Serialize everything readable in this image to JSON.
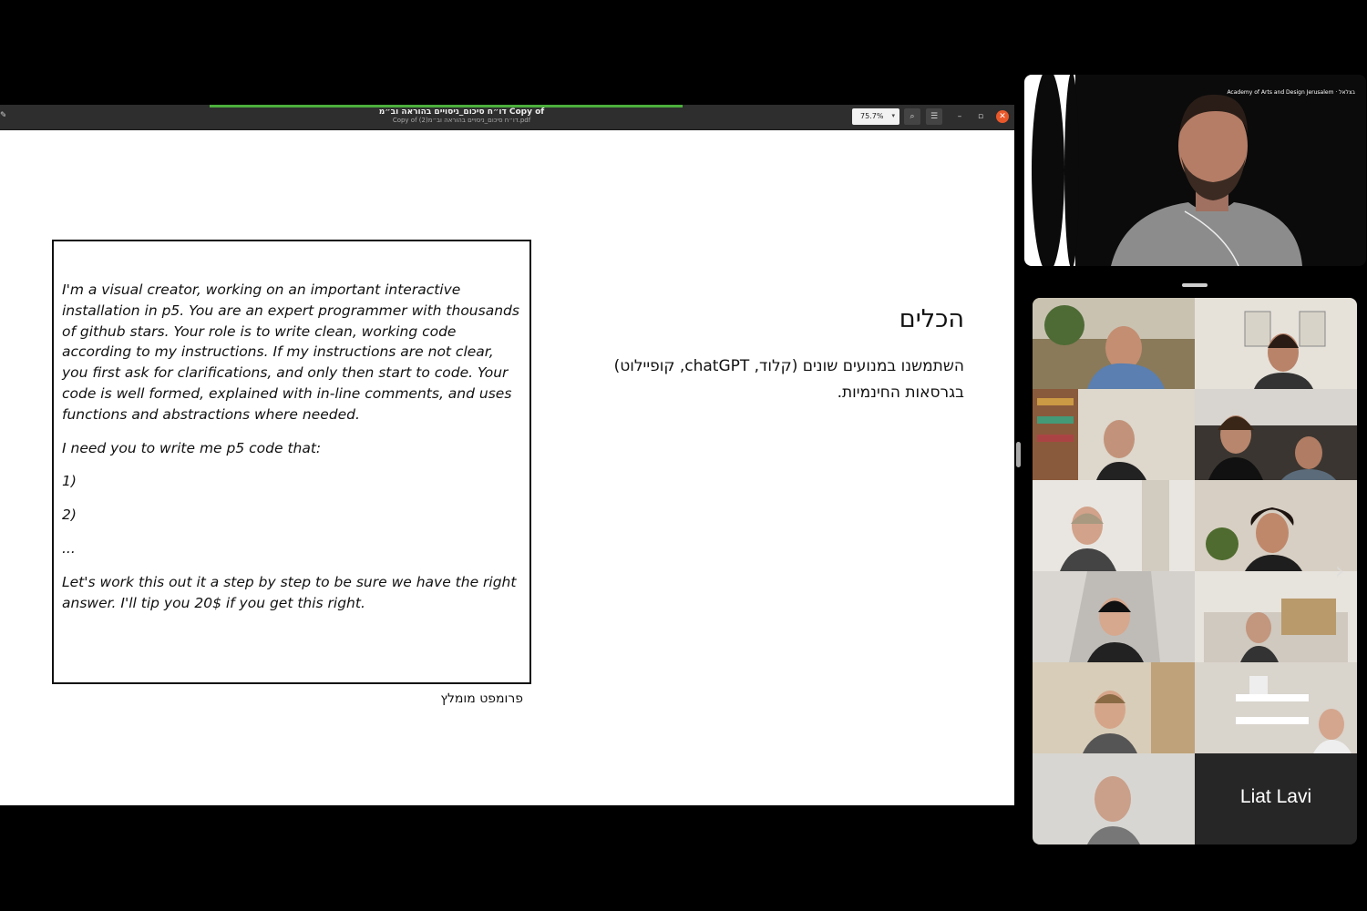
{
  "window": {
    "title": "דו״ח סיכום_ניסויים בהוראה וב״מ Copy of",
    "subtitle": "Copy of (2)דו״ח סיכום_ניסויים בהוראה וב״מ.pdf",
    "zoom": "75.7%",
    "zoom_caret": "▾",
    "icons": [
      "edit-icon",
      "search-icon",
      "menu-icon",
      "minimize-icon",
      "maximize-icon",
      "close-icon"
    ],
    "icon_glyphs": {
      "edit": "✎",
      "search": "⌕",
      "menu": "☰",
      "minimize": "–",
      "maximize": "▫",
      "close": "✕"
    },
    "load_progress": 0.47
  },
  "slide": {
    "prompt_paragraphs": [
      "I'm a visual creator, working on an important interactive installation in p5. You are an expert programmer with thousands of github stars. Your role is to write clean, working code according to my instructions. If my instructions are not clear, you first ask for clarifications, and only then start to code. Your code is well formed, explained with in-line comments, and uses functions and abstractions where needed.",
      "I need you to write me p5 code that:",
      "1)",
      "2)",
      "...",
      "Let's work this out it a step by step to be sure we have the right answer. I'll tip you 20$ if you get this right."
    ],
    "prompt_caption": "פרומפט מומלץ",
    "title": "הכלים",
    "body": "השתמשנו במנועים שונים (קלוד, chatGPT, קופיילוט) בגרסאות החינמיות."
  },
  "speaker": {
    "logo_text": "Academy of Arts and Design Jerusalem · בצלאל"
  },
  "gallery": {
    "participant_name": "Liat Lavi",
    "next_glyph": "›"
  },
  "colors": {
    "titlebar": "#2e2e2e",
    "progress": "#4caf3d",
    "close": "#e9582a"
  }
}
